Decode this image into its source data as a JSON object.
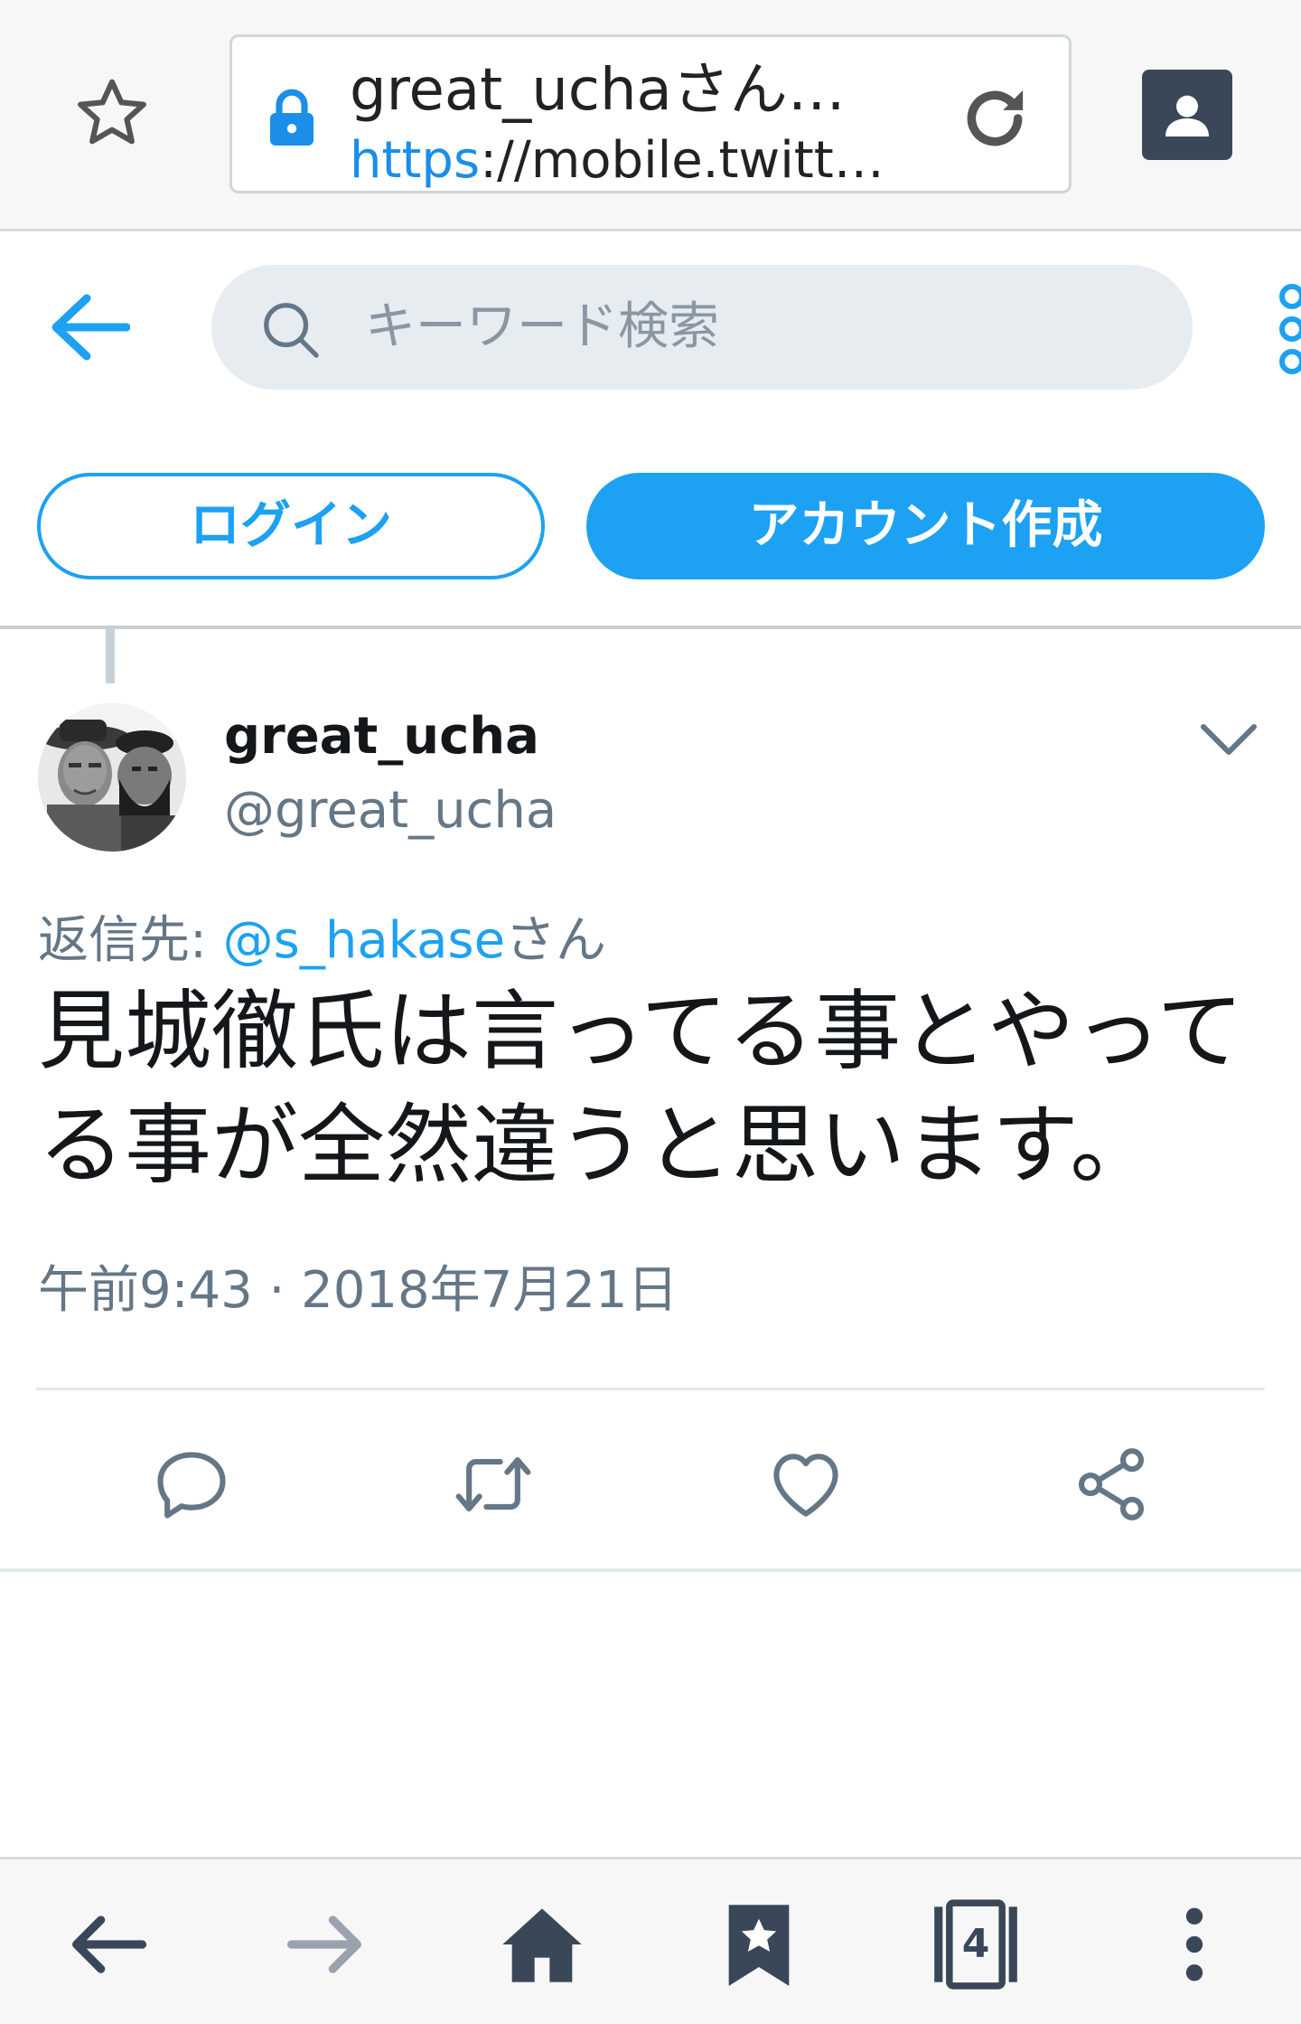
{
  "browser": {
    "page_title": "great_uchaさん…",
    "url_scheme": "https",
    "url_rest": "://mobile.twitt…",
    "tabs_count": "4"
  },
  "header": {
    "search_placeholder": "キーワード検索",
    "login_label": "ログイン",
    "signup_label": "アカウント作成"
  },
  "tweet": {
    "display_name": "great_ucha",
    "handle": "@great_ucha",
    "reply_prefix": "返信先: ",
    "reply_mention": "@s_hakase",
    "reply_suffix": "さん",
    "text": "見城徹氏は言ってる事とやってる事が全然違うと思います。",
    "timestamp": "午前9:43 · 2018年7月21日"
  },
  "icons": {
    "bookmark_add": "star-outline-icon",
    "lock": "lock-icon",
    "reload": "reload-icon",
    "profile": "profile-icon",
    "back": "back-arrow-icon",
    "search": "search-icon",
    "more": "more-dots-icon",
    "reply": "reply-icon",
    "retweet": "retweet-icon",
    "like": "heart-icon",
    "share": "share-icon",
    "nav_back": "nav-back-icon",
    "nav_forward": "nav-forward-icon",
    "home": "home-icon",
    "bookmarks": "bookmarks-icon",
    "tabs": "tabs-icon",
    "menu": "menu-dots-icon"
  },
  "colors": {
    "twitter_blue": "#1da1f2",
    "secondary_text": "#657786",
    "chrome_dark": "#3a4759"
  }
}
